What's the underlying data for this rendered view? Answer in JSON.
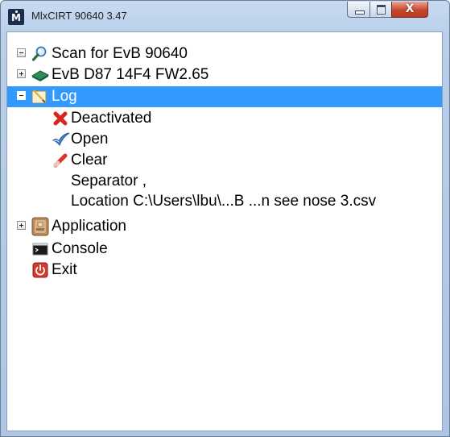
{
  "window": {
    "title": "MlxCIRT 90640 3.47",
    "close_symbol": "X",
    "icon_letter": "M"
  },
  "tree": {
    "scan": {
      "label": "Scan for EvB 90640",
      "icon": "search-icon"
    },
    "evb": {
      "label": "EvB D87 14F4 FW2.65",
      "icon": "board-icon"
    },
    "log": {
      "label": "Log",
      "icon": "log-icon",
      "children": {
        "deactivated": {
          "label": "Deactivated",
          "icon": "red-x-icon"
        },
        "open": {
          "label": "Open",
          "icon": "check-icon"
        },
        "clear": {
          "label": "Clear",
          "icon": "eraser-icon"
        },
        "separator": {
          "label": "Separator ,"
        },
        "location": {
          "label": "Location C:\\Users\\lbu\\...B ...n see nose 3.csv"
        }
      }
    },
    "application": {
      "label": "Application",
      "icon": "application-icon"
    },
    "console": {
      "label": "Console",
      "icon": "console-icon"
    },
    "exit": {
      "label": "Exit",
      "icon": "power-icon"
    }
  },
  "colors": {
    "selection": "#3399ff",
    "title_bar": "#b9cfe9",
    "close_button": "#c9462c"
  }
}
